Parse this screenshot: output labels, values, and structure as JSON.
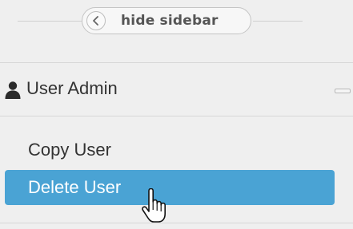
{
  "sidebar": {
    "toggle": {
      "label": "hide sidebar",
      "icon": "chevron-left-icon"
    },
    "section": {
      "title": "User Admin",
      "icon": "user-icon",
      "collapse_icon": "minus-icon",
      "items": [
        {
          "label": "Copy User",
          "selected": false
        },
        {
          "label": "Delete User",
          "selected": true
        }
      ]
    }
  },
  "colors": {
    "background": "#efefef",
    "selected_item": "#4aa3d4",
    "text": "#333333",
    "selected_text": "#ffffff"
  },
  "cursor": {
    "type": "hand-pointer"
  }
}
